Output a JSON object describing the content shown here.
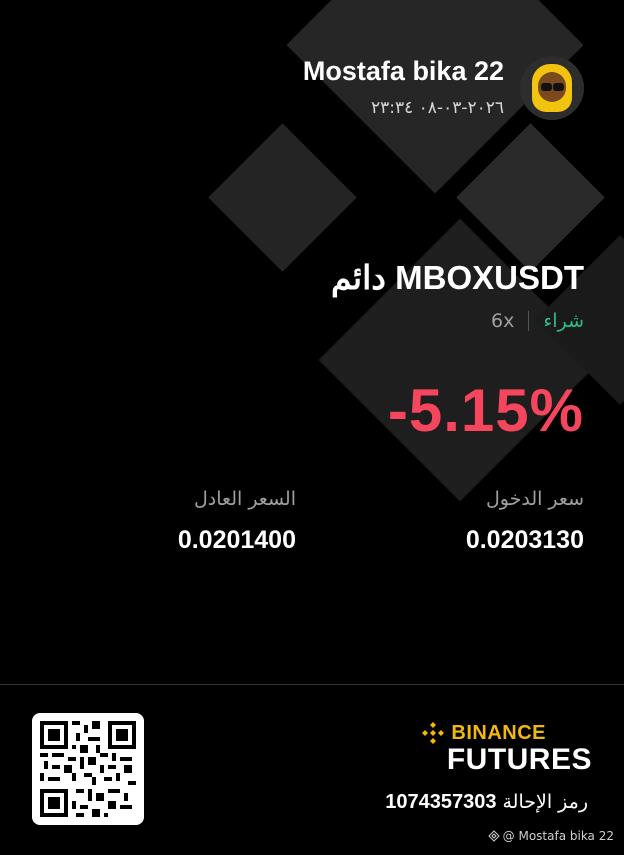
{
  "header": {
    "username": "Mostafa bika 22",
    "datetime": "٢٠٢٦-٠٣-٠٨ ٢٣:٣٤"
  },
  "position": {
    "symbol": "MBOXUSDT دائم",
    "side": "شراء",
    "leverage": "6x",
    "pnl_percent": "-5.15%"
  },
  "prices": {
    "entry_label": "سعر الدخول",
    "entry_value": "0.0203130",
    "fair_label": "السعر العادل",
    "fair_value": "0.0201400"
  },
  "footer": {
    "brand_top": "BINANCE",
    "brand_bottom": "FUTURES",
    "referral_label": "رمز الإحالة",
    "referral_code": "1074357303",
    "watermark": "@ Mostafa bika 22"
  },
  "colors": {
    "positive": "#2ebd85",
    "negative": "#f6465d",
    "brand": "#f0b90b"
  }
}
